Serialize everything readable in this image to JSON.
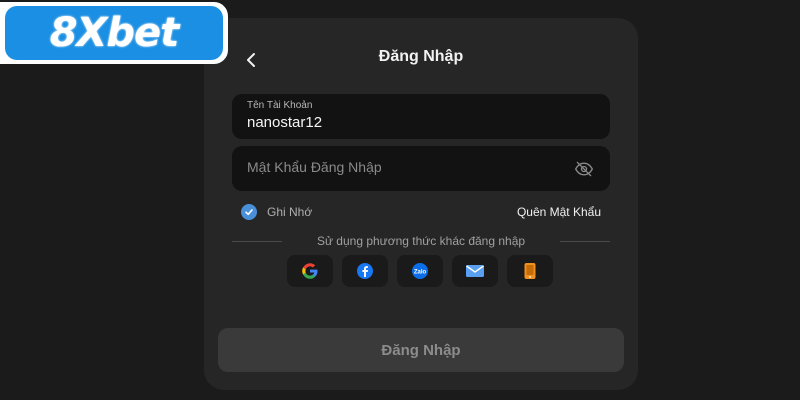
{
  "brand": {
    "logo_text": "8Xbet",
    "logo_color": "#1a8fe3"
  },
  "login": {
    "title": "Đăng Nhập",
    "back_icon": "chevron-left-icon",
    "username": {
      "label": "Tên Tài Khoản",
      "value": "nanostar12"
    },
    "password": {
      "placeholder": "Mật Khẩu Đăng Nhập",
      "visibility_icon": "eye-off-icon"
    },
    "remember": {
      "label": "Ghi Nhớ",
      "checked": true,
      "accent": "#4a90d9"
    },
    "forgot_label": "Quên Mật Khẩu",
    "alt_methods_label": "Sử dụng phương thức khác đăng nhập",
    "social_methods": [
      {
        "name": "google",
        "icon": "google-icon"
      },
      {
        "name": "facebook",
        "icon": "facebook-icon"
      },
      {
        "name": "zalo",
        "icon": "zalo-icon"
      },
      {
        "name": "email",
        "icon": "mail-icon"
      },
      {
        "name": "phone",
        "icon": "phone-icon"
      }
    ],
    "submit_label": "Đăng Nhập"
  }
}
